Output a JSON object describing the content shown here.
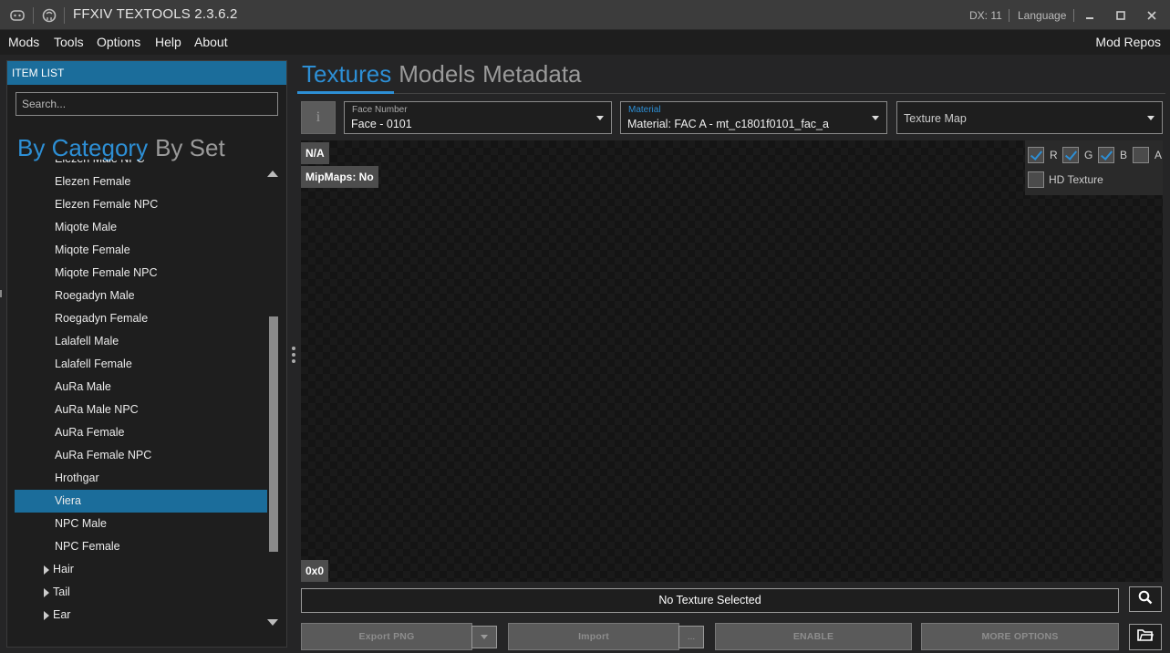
{
  "titlebar": {
    "app_title": "FFXIV TEXTOOLS 2.3.6.2",
    "dx": "DX: 11",
    "language": "Language",
    "icons": [
      "discord-icon",
      "github-icon"
    ],
    "window_buttons": [
      "minimize",
      "maximize",
      "close"
    ]
  },
  "menu": {
    "items": [
      "Mods",
      "Tools",
      "Options",
      "Help",
      "About"
    ],
    "right": "Mod Repos"
  },
  "item_list": {
    "header": "ITEM LIST",
    "search_placeholder": "Search...",
    "tabs": [
      "By Category",
      "By Set"
    ],
    "rows": [
      {
        "label": "Elezen Male NPC",
        "type": "leaf"
      },
      {
        "label": "Elezen Female",
        "type": "leaf"
      },
      {
        "label": "Elezen Female NPC",
        "type": "leaf"
      },
      {
        "label": "Miqote Male",
        "type": "leaf"
      },
      {
        "label": "Miqote Female",
        "type": "leaf"
      },
      {
        "label": "Miqote Female NPC",
        "type": "leaf"
      },
      {
        "label": "Roegadyn Male",
        "type": "leaf"
      },
      {
        "label": "Roegadyn Female",
        "type": "leaf"
      },
      {
        "label": "Lalafell Male",
        "type": "leaf"
      },
      {
        "label": "Lalafell Female",
        "type": "leaf"
      },
      {
        "label": "AuRa Male",
        "type": "leaf"
      },
      {
        "label": "AuRa Male NPC",
        "type": "leaf"
      },
      {
        "label": "AuRa Female",
        "type": "leaf"
      },
      {
        "label": "AuRa Female NPC",
        "type": "leaf"
      },
      {
        "label": "Hrothgar",
        "type": "leaf"
      },
      {
        "label": "Viera",
        "type": "leaf",
        "selected": true
      },
      {
        "label": "NPC Male",
        "type": "leaf"
      },
      {
        "label": "NPC Female",
        "type": "leaf"
      },
      {
        "label": "Hair",
        "type": "parent"
      },
      {
        "label": "Tail",
        "type": "parent"
      },
      {
        "label": "Ear",
        "type": "parent"
      }
    ]
  },
  "main": {
    "tabs": [
      "Textures",
      "Models",
      "Metadata"
    ],
    "active_tab": "Textures",
    "info_icon": "i",
    "face_number": {
      "label": "Face Number",
      "value": "Face - 0101"
    },
    "material": {
      "label": "Material",
      "value": "Material: FAC A - mt_c1801f0101_fac_a"
    },
    "texture_map": {
      "value": "Texture Map"
    },
    "viewer": {
      "format": "N/A",
      "mipmaps": "MipMaps: No",
      "size": "0x0",
      "channels": [
        {
          "label": "R",
          "checked": true
        },
        {
          "label": "G",
          "checked": true
        },
        {
          "label": "B",
          "checked": true
        },
        {
          "label": "A",
          "checked": false
        }
      ],
      "hd_texture": {
        "label": "HD Texture",
        "checked": false
      }
    },
    "status": "No Texture Selected",
    "buttons": {
      "export": "Export PNG",
      "import": "Import",
      "import_more": "...",
      "enable": "ENABLE",
      "more_options": "MORE OPTIONS"
    }
  },
  "colors": {
    "accent": "#2d8fd5",
    "header_blue": "#1b6d9b",
    "background": "#252526"
  }
}
